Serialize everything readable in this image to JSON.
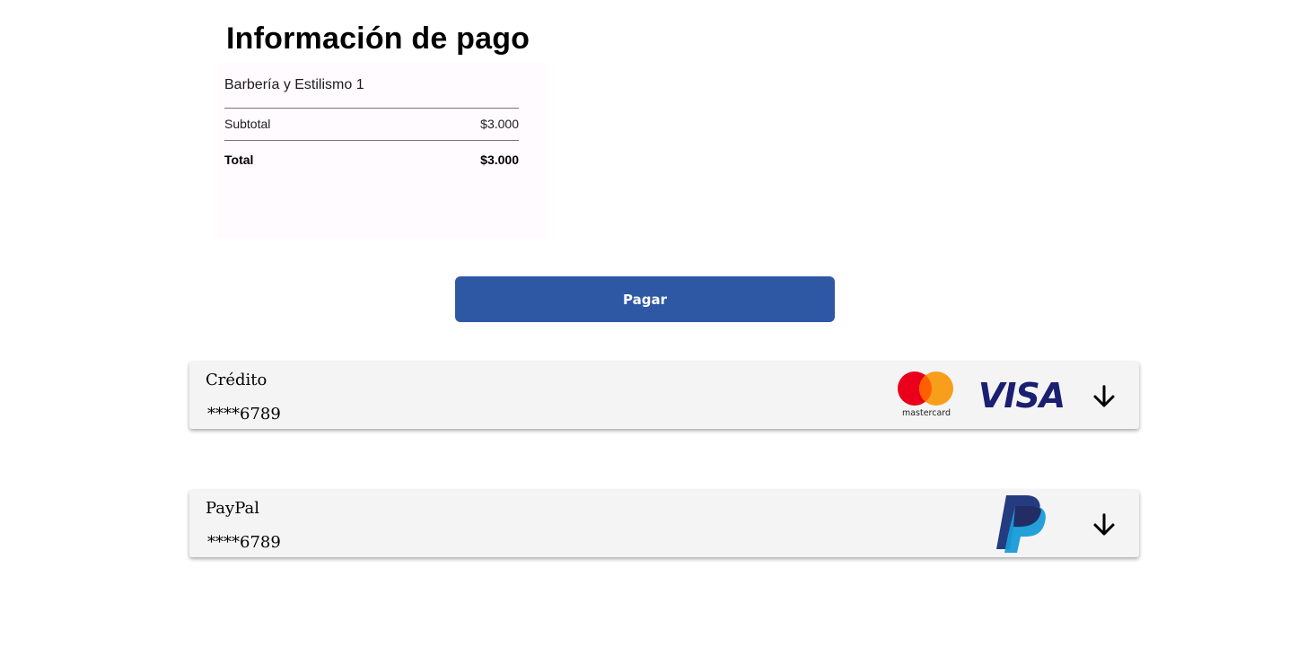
{
  "header": {
    "title": "Información de pago"
  },
  "summary": {
    "business_name": "Barbería y Estilismo 1",
    "subtotal_label": "Subtotal",
    "subtotal_value": "$3.000",
    "total_label": "Total",
    "total_value": "$3.000"
  },
  "actions": {
    "pay_label": "Pagar"
  },
  "payment_methods": [
    {
      "name": "Crédito",
      "masked_number": "****6789",
      "logos": [
        "mastercard-logo",
        "visa-logo"
      ],
      "logo_text": {
        "mastercard": "mastercard",
        "visa": "VISA"
      },
      "expand_icon": "arrow-down-icon"
    },
    {
      "name": "PayPal",
      "masked_number": "****6789",
      "logos": [
        "paypal-logo"
      ],
      "expand_icon": "arrow-down-icon"
    }
  ],
  "colors": {
    "primary_button": "#2f58a4",
    "card_background": "#f4f4f4",
    "summary_background": "#fffbfe",
    "mastercard_red": "#eb001b",
    "mastercard_orange": "#f79e1b",
    "visa_navy": "#1a1f71",
    "paypal_dark": "#253b80",
    "paypal_light": "#179bd7"
  }
}
